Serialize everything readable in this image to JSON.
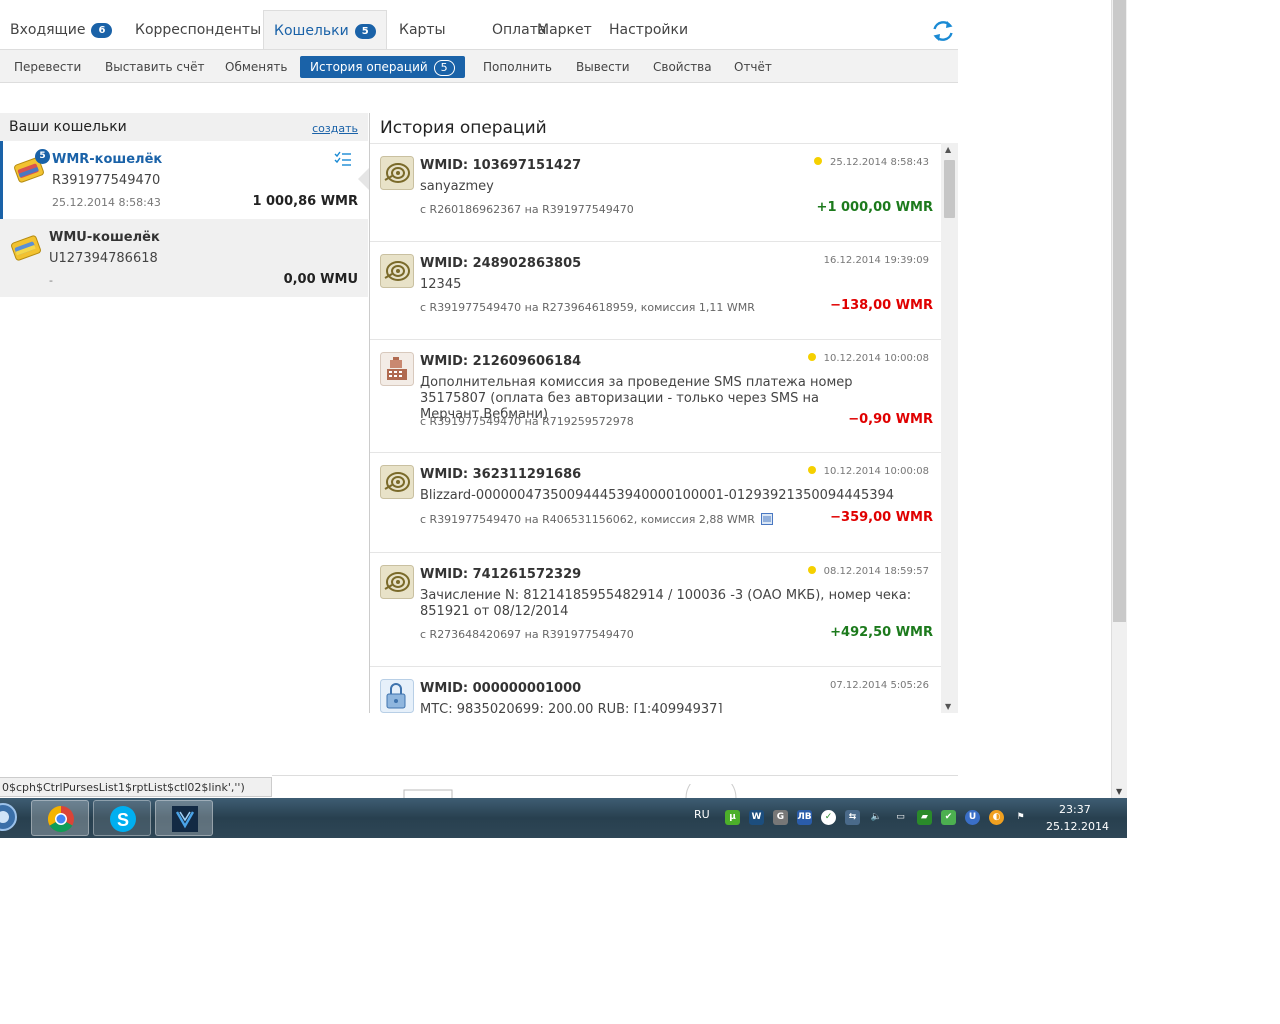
{
  "top_tabs": [
    {
      "label": "Входящие",
      "badge": "6"
    },
    {
      "label": "Корреспонденты"
    },
    {
      "label": "Кошельки",
      "badge": "5",
      "active": true
    },
    {
      "label": "Карты"
    },
    {
      "label": "Оплата"
    },
    {
      "label": "Маркет"
    },
    {
      "label": "Настройки"
    }
  ],
  "sub_tabs": [
    {
      "label": "Перевести"
    },
    {
      "label": "Выставить счёт"
    },
    {
      "label": "Обменять"
    },
    {
      "label": "История операций",
      "badge": "5",
      "active": true
    },
    {
      "label": "Пополнить"
    },
    {
      "label": "Вывести"
    },
    {
      "label": "Свойства"
    },
    {
      "label": "Отчёт"
    }
  ],
  "purses": {
    "title": "Ваши кошельки",
    "create": "создать",
    "items": [
      {
        "name": "WMR-кошелёк",
        "number": "R391977549470",
        "date": "25.12.2014 8:58:43",
        "balance": "1 000,86 WMR",
        "badge": "5"
      },
      {
        "name": "WMU-кошелёк",
        "number": "U127394786618",
        "date": "-",
        "balance": "0,00 WMU"
      }
    ]
  },
  "history": {
    "title": "История операций",
    "operations": [
      {
        "wmid": "WMID: 103697151427",
        "desc": "sanyazmey",
        "route": "с R260186962367 на R391977549470",
        "datetime": "25.12.2014 8:58:43",
        "amount": "+1 000,00 WMR",
        "dot": true,
        "positive": true,
        "icon": "wm-icon"
      },
      {
        "wmid": "WMID: 248902863805",
        "desc": "12345",
        "route": "с R391977549470 на R273964618959, комиссия 1,11 WMR",
        "datetime": "16.12.2014 19:39:09",
        "amount": "−138,00 WMR",
        "dot": false,
        "positive": false,
        "icon": "wm-icon"
      },
      {
        "wmid": "WMID: 212609606184",
        "desc": "Дополнительная комиссия за проведение SMS платежа номер 35175807 (оплата без авторизации - только через SMS на Мерчант.Вебмани)",
        "route": "с R391977549470 на R719259572978",
        "datetime": "10.12.2014 10:00:08",
        "amount": "−0,90 WMR",
        "dot": true,
        "positive": false,
        "icon": "cash-register-icon"
      },
      {
        "wmid": "WMID: 362311291686",
        "desc": "Blizzard-000000473500944453940000100001-01293921350094445394",
        "route": "с R391977549470 на R406531156062, комиссия 2,88 WMR",
        "datetime": "10.12.2014 10:00:08",
        "amount": "−359,00 WMR",
        "dot": true,
        "positive": false,
        "icon": "wm-icon"
      },
      {
        "wmid": "WMID: 741261572329",
        "desc": "Зачисление N: 81214185955482914 / 100036 -3 (ОАО МКБ), номер чека: 851921 от 08/12/2014",
        "route": "с R273648420697 на R391977549470",
        "datetime": "08.12.2014 18:59:57",
        "amount": "+492,50 WMR",
        "dot": true,
        "positive": true,
        "icon": "wm-icon"
      },
      {
        "wmid": "WMID: 000000001000",
        "desc": "МТС: 9835020699: 200.00 RUB: [1:40994937]",
        "route": "",
        "datetime": "07.12.2014 5:05:26",
        "amount": "",
        "dot": false,
        "positive": false,
        "icon": "lock-icon"
      }
    ]
  },
  "status_text": "0$cph$CtrlPursesList1$rptList$ctl02$link','')",
  "taskbar": {
    "lang": "RU",
    "time": "23:37",
    "date": "25.12.2014",
    "apps": [
      "start-orb-icon",
      "chrome-icon",
      "skype-icon",
      "webmoney-keeper-icon"
    ]
  },
  "colors": {
    "accent": "#1a62a8",
    "positive": "#1c7a1c",
    "negative": "#e00000"
  }
}
